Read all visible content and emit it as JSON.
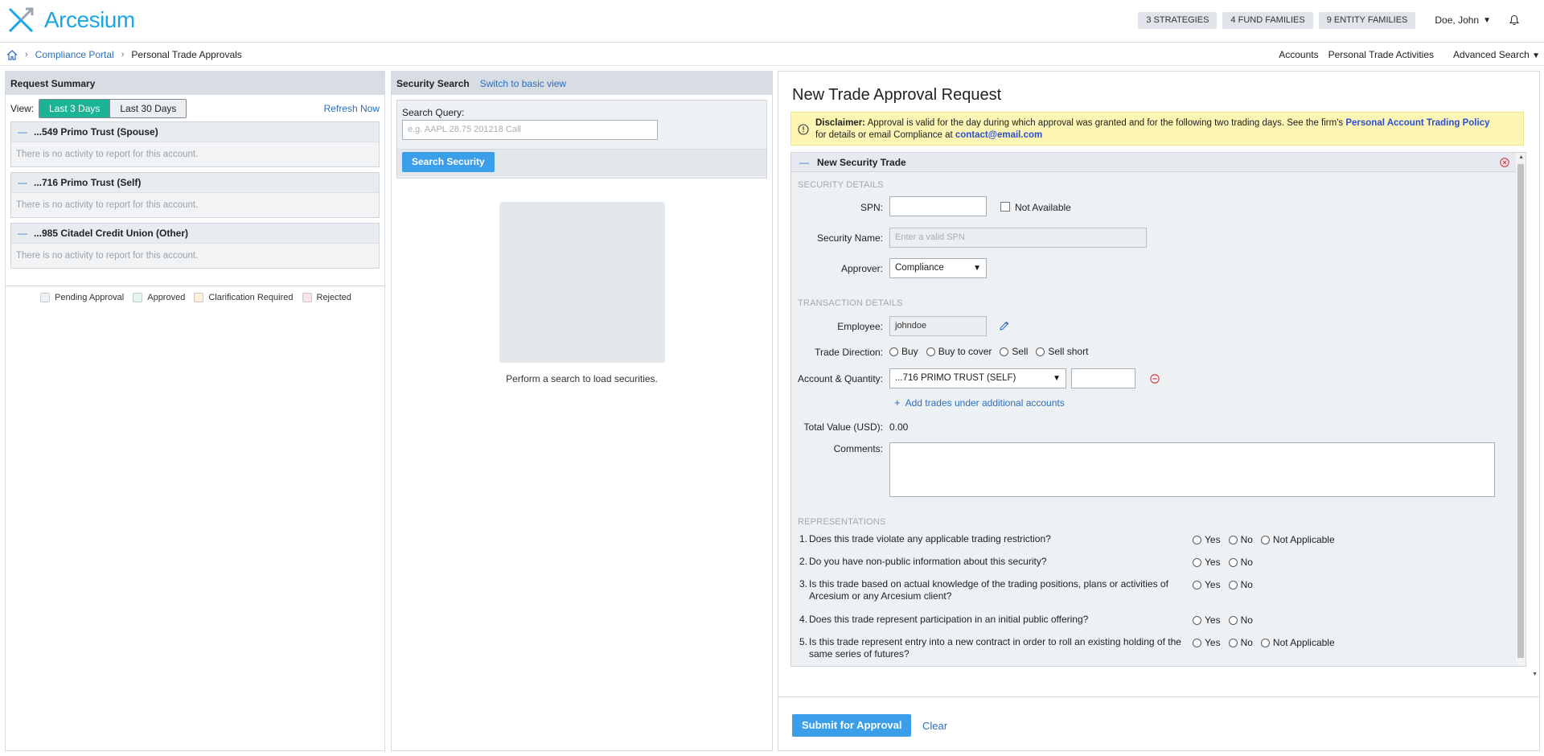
{
  "header": {
    "logo_text": "Arcesium",
    "pills": [
      "3 STRATEGIES",
      "4 FUND FAMILIES",
      "9 ENTITY FAMILIES"
    ],
    "user": "Doe, John",
    "user_caret": "▼"
  },
  "breadcrumb": {
    "sep": "›",
    "portal": "Compliance Portal",
    "current": "Personal Trade Approvals",
    "right_links": [
      "Accounts",
      "Personal Trade Activities",
      "Advanced Search"
    ],
    "advanced_caret": "▼"
  },
  "request_summary": {
    "title": "Request Summary",
    "view_label": "View:",
    "views": [
      "Last 3 Days",
      "Last 30 Days"
    ],
    "active_view": "Last 3 Days",
    "refresh": "Refresh Now",
    "accounts": [
      {
        "name": "...549 Primo Trust (Spouse)",
        "empty": "There is no activity to report for this account."
      },
      {
        "name": "...716 Primo Trust (Self)",
        "empty": "There is no activity to report for this account."
      },
      {
        "name": "...985 Citadel Credit Union (Other)",
        "empty": "There is no activity to report for this account."
      }
    ],
    "legend": [
      {
        "label": "Pending Approval",
        "color": "#eef1f5"
      },
      {
        "label": "Approved",
        "color": "#e6f6ee"
      },
      {
        "label": "Clarification Required",
        "color": "#fdf1dc"
      },
      {
        "label": "Rejected",
        "color": "#fbe4e4"
      }
    ]
  },
  "security_search": {
    "title": "Security Search",
    "switch_link": "Switch to basic view",
    "query_label": "Search Query:",
    "query_placeholder": "e.g. AAPL 28.75 201218 Call",
    "button": "Search Security",
    "empty_message": "Perform a search to load securities."
  },
  "trade_request": {
    "title": "New Trade Approval Request",
    "disclaimer": {
      "label": "Disclaimer:",
      "text1": " Approval is valid for the day during which approval was granted and for the following two trading days. See the firm's ",
      "policy_link": "Personal Account Trading Policy",
      "text2": "for details or email Compliance at ",
      "email": "contact@email.com"
    },
    "section_title": "New Security Trade",
    "security_details_label": "SECURITY DETAILS",
    "spn_label": "SPN:",
    "spn_value": "",
    "not_available_label": "Not Available",
    "security_name_label": "Security Name:",
    "security_name_placeholder": "Enter a valid SPN",
    "approver_label": "Approver:",
    "approver_value": "Compliance",
    "transaction_details_label": "TRANSACTION DETAILS",
    "employee_label": "Employee:",
    "employee_value": "johndoe",
    "trade_direction_label": "Trade Direction:",
    "trade_directions": [
      "Buy",
      "Buy to cover",
      "Sell",
      "Sell short"
    ],
    "account_quantity_label": "Account & Quantity:",
    "account_value": "...716 PRIMO TRUST (SELF)",
    "quantity_value": "",
    "add_trades": "Add trades under additional accounts",
    "total_value_label": "Total Value (USD):",
    "total_value": "0.00",
    "comments_label": "Comments:",
    "comments_value": "",
    "representations_label": "REPRESENTATIONS",
    "questions": [
      {
        "num": "1.",
        "text": "Does this trade violate any applicable trading restriction?",
        "options": [
          "Yes",
          "No",
          "Not Applicable"
        ]
      },
      {
        "num": "2.",
        "text": "Do you have non-public information about this security?",
        "options": [
          "Yes",
          "No"
        ]
      },
      {
        "num": "3.",
        "text": "Is this trade based on actual knowledge of the trading positions, plans or activities of Arcesium or any Arcesium client?",
        "options": [
          "Yes",
          "No"
        ]
      },
      {
        "num": "4.",
        "text": "Does this trade represent participation in an initial public offering?",
        "options": [
          "Yes",
          "No"
        ]
      },
      {
        "num": "5.",
        "text": "Is this trade represent entry into a new contract in order to roll an existing holding of the same series of futures?",
        "options": [
          "Yes",
          "No",
          "Not Applicable"
        ]
      }
    ],
    "submit": "Submit for Approval",
    "clear": "Clear"
  },
  "colors": {
    "brand": "#1aa6e6",
    "accent_green": "#1ab394",
    "button_blue": "#3a9ee8",
    "link_blue": "#2c6ebf",
    "disclaimer_bg": "#fdf5b4"
  }
}
